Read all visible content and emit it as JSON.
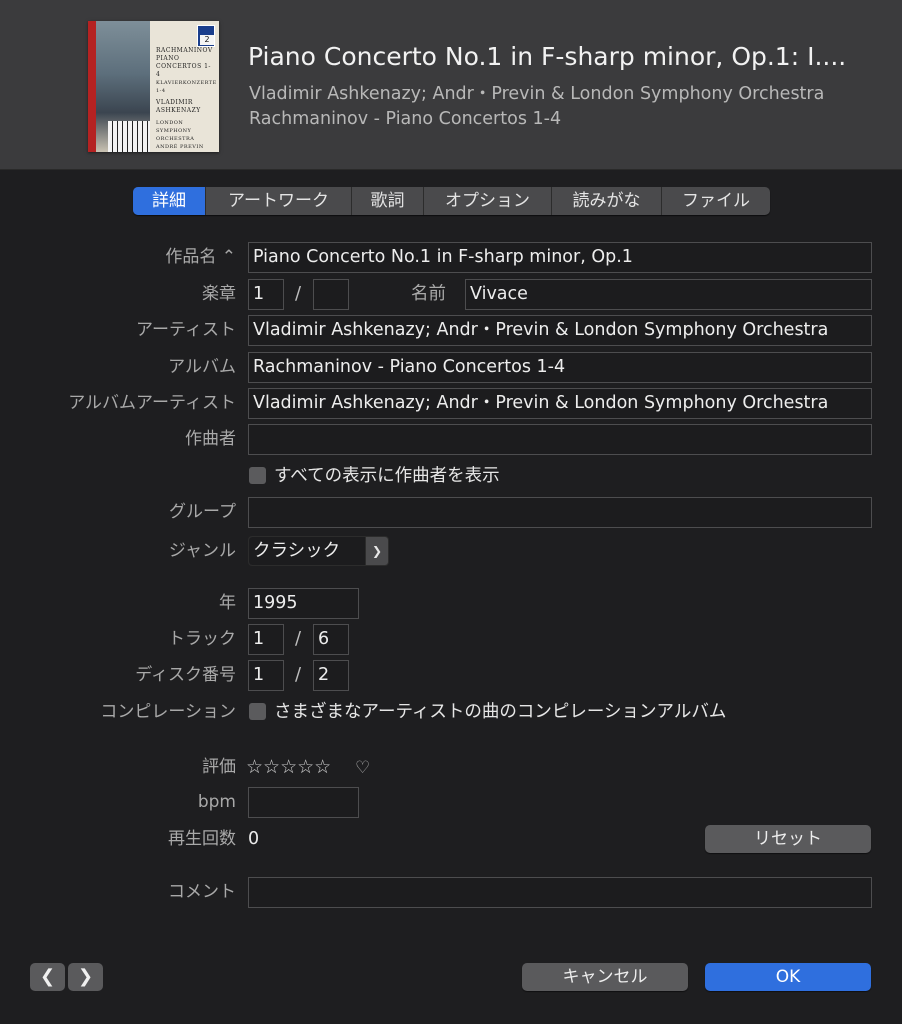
{
  "header": {
    "title": "Piano Concerto No.1 in F-sharp minor, Op.1: I....",
    "artist": "Vladimir Ashkenazy; Andr・Previn & London Symphony Orchestra",
    "album": "Rachmaninov - Piano Concertos 1-4",
    "artwork": {
      "badge": "2",
      "text_lines": [
        "RACHMANINOV",
        "PIANO",
        "CONCERTOS 1-4",
        "KLAVIERKONZERTE 1-4",
        "VLADIMIR",
        "ASHKENAZY",
        "LONDON SYMPHONY",
        "ORCHESTRA",
        "ANDRÉ PREVIN"
      ]
    }
  },
  "tabs": [
    {
      "label": "詳細",
      "active": true
    },
    {
      "label": "アートワーク",
      "active": false
    },
    {
      "label": "歌詞",
      "active": false
    },
    {
      "label": "オプション",
      "active": false
    },
    {
      "label": "読みがな",
      "active": false
    },
    {
      "label": "ファイル",
      "active": false
    }
  ],
  "form": {
    "work_label": "作品名 ⌃",
    "work_value": "Piano Concerto No.1 in F-sharp minor, Op.1",
    "movement_label": "楽章",
    "movement_number": "1",
    "movement_count": "",
    "movement_name_label": "名前",
    "movement_name": "Vivace",
    "artist_label": "アーティスト",
    "artist_value": "Vladimir Ashkenazy; Andr・Previn & London Symphony Orchestra",
    "album_label": "アルバム",
    "album_value": "Rachmaninov - Piano Concertos 1-4",
    "album_artist_label": "アルバムアーティスト",
    "album_artist_value": "Vladimir Ashkenazy; Andr・Previn & London Symphony Orchestra",
    "composer_label": "作曲者",
    "composer_value": "",
    "show_composer_label": "すべての表示に作曲者を表示",
    "show_composer_checked": false,
    "grouping_label": "グループ",
    "grouping_value": "",
    "genre_label": "ジャンル",
    "genre_value": "クラシック",
    "year_label": "年",
    "year_value": "1995",
    "track_label": "トラック",
    "track_number": "1",
    "track_total": "6",
    "disc_label": "ディスク番号",
    "disc_number": "1",
    "disc_total": "2",
    "compilation_label": "コンピレーション",
    "compilation_text": "さまざまなアーティストの曲のコンピレーションアルバム",
    "compilation_checked": false,
    "rating_label": "評価",
    "rating_stars": "☆☆☆☆☆",
    "rating_value": 0,
    "love_icon": "heart-outline-icon",
    "bpm_label": "bpm",
    "bpm_value": "",
    "play_count_label": "再生回数",
    "play_count_value": "0",
    "reset_label": "リセット",
    "comment_label": "コメント",
    "comment_value": ""
  },
  "footer": {
    "prev_icon": "chevron-left-icon",
    "next_icon": "chevron-right-icon",
    "cancel_label": "キャンセル",
    "ok_label": "OK"
  },
  "colors": {
    "accent": "#2f6fde",
    "window_bg": "#1e1e20",
    "header_bg": "#3b3b3d"
  }
}
